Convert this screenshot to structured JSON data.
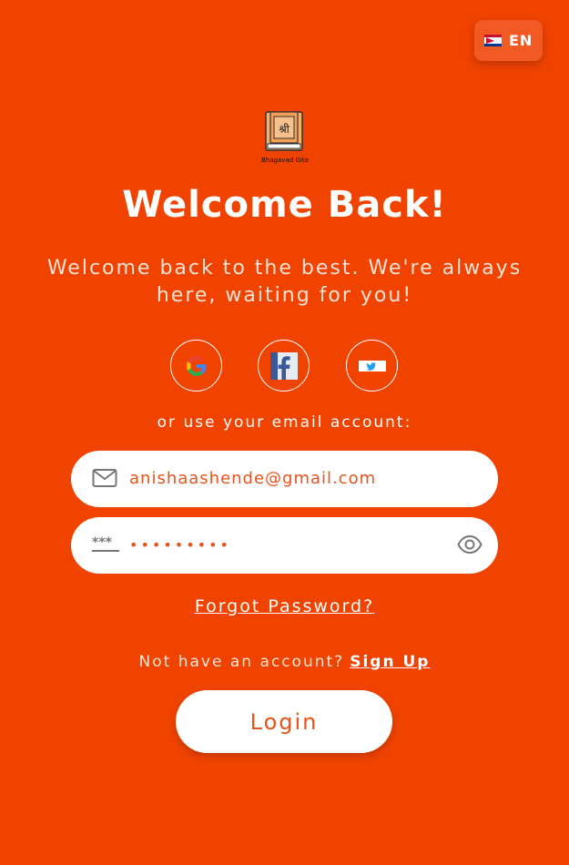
{
  "language": {
    "label": "EN",
    "flag_icon": "nepal-flag-icon"
  },
  "logo": {
    "text": "Bhagavad Gita",
    "symbol": "श्री"
  },
  "title": "Welcome Back!",
  "subtitle": "Welcome back to the best. We're always here, waiting for you!",
  "social": [
    {
      "icon": "google-icon"
    },
    {
      "icon": "facebook-icon"
    },
    {
      "icon": "twitter-icon"
    }
  ],
  "or_text": "or use your email account:",
  "email": {
    "value": "anishaashende@gmail.com",
    "icon": "mail-icon"
  },
  "password": {
    "masked_value": "•••••••••",
    "icon": "password-icon",
    "toggle_icon": "eye-icon"
  },
  "forgot_password": "Forgot Password?",
  "signup": {
    "prompt": "Not have an account?",
    "link": "Sign Up"
  },
  "login_button": "Login",
  "colors": {
    "background": "#F04300",
    "accent_text": "#E8531C",
    "white": "#FFFFFF"
  }
}
